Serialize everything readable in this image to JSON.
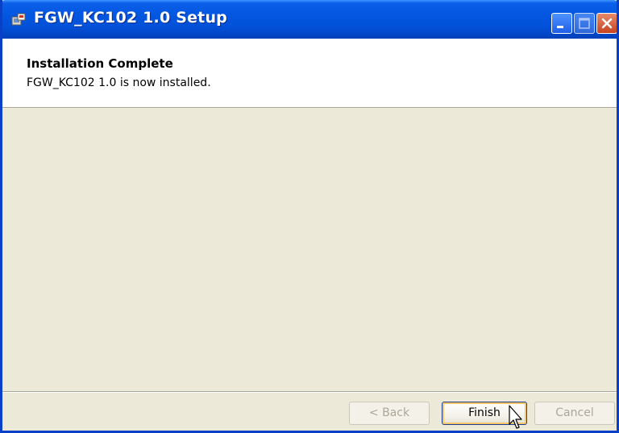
{
  "window": {
    "title": "FGW_KC102 1.0 Setup"
  },
  "header": {
    "title": "Installation Complete",
    "subtitle": "FGW_KC102 1.0 is now installed."
  },
  "buttons": {
    "back_label": "< Back",
    "finish_label": "Finish",
    "cancel_label": "Cancel"
  },
  "icons": {
    "app": "installer-icon",
    "minimize": "minimize-icon",
    "maximize": "maximize-icon",
    "close": "close-icon",
    "cursor": "mouse-pointer-icon"
  },
  "colors": {
    "titlebar": "#0356e0",
    "dialog_background": "#ece9d8",
    "header_background": "#ffffff",
    "close_button": "#c8421f",
    "disabled_text": "#aca899"
  }
}
